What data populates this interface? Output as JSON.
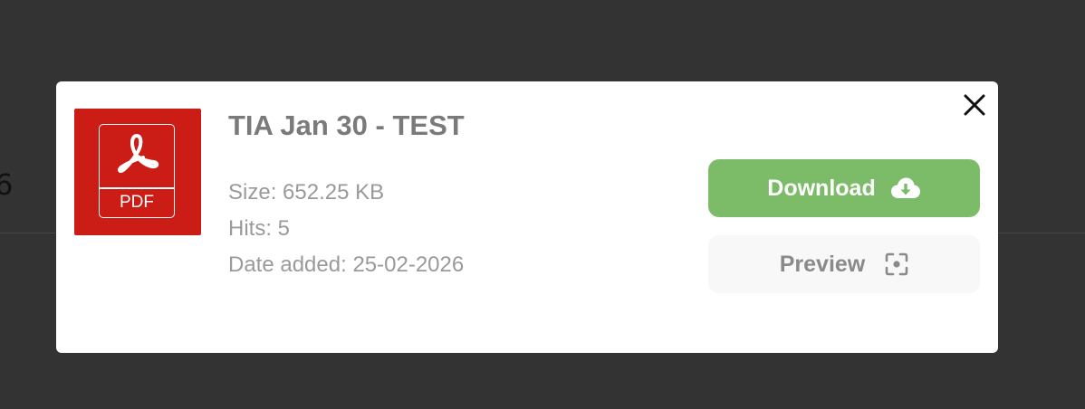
{
  "backdrop": {
    "partial_text": "6"
  },
  "modal": {
    "file": {
      "icon_name": "pdf-file-icon",
      "type_label": "PDF",
      "title": "TIA Jan 30 - TEST",
      "size": "Size: 652.25 KB",
      "hits": "Hits: 5",
      "date_added": "Date added: 25-02-2026"
    },
    "actions": {
      "download_label": "Download",
      "download_icon": "cloud-download-icon",
      "preview_label": "Preview",
      "preview_icon": "focus-frame-icon"
    },
    "close_icon": "close-icon"
  },
  "colors": {
    "backdrop": "#333333",
    "modal_bg": "#ffffff",
    "pdf_red": "#cb1c16",
    "download_green": "#7cbb68",
    "preview_bg": "#f8f8f8",
    "title_text": "#7a7a7a",
    "meta_text": "#9a9a9a"
  }
}
